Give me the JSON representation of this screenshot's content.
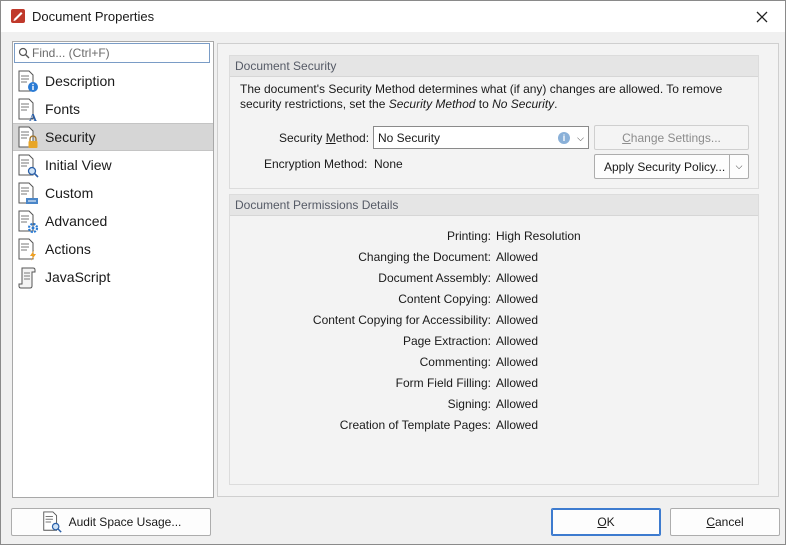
{
  "window": {
    "title": "Document Properties"
  },
  "sidebar": {
    "search_placeholder": "Find... (Ctrl+F)",
    "items": [
      {
        "label": "Description",
        "icon": "document-info-icon"
      },
      {
        "label": "Fonts",
        "icon": "document-font-icon"
      },
      {
        "label": "Security",
        "icon": "document-lock-icon",
        "selected": true
      },
      {
        "label": "Initial View",
        "icon": "document-view-icon"
      },
      {
        "label": "Custom",
        "icon": "document-custom-icon"
      },
      {
        "label": "Advanced",
        "icon": "document-gear-icon"
      },
      {
        "label": "Actions",
        "icon": "document-lightning-icon"
      },
      {
        "label": "JavaScript",
        "icon": "script-scroll-icon"
      }
    ]
  },
  "security": {
    "header": "Document Security",
    "desc_line1": "The document's Security Method determines what (if any) changes are allowed. To remove",
    "desc_line2_prefix": "security restrictions, set the ",
    "desc_line2_italic1": "Security Method",
    "desc_line2_mid": " to ",
    "desc_line2_italic2": "No Security",
    "desc_line2_suffix": ".",
    "method_label_prefix": "Security ",
    "method_label_underlined": "M",
    "method_label_suffix": "ethod:",
    "method_value": "No Security",
    "encryption_label": "Encryption Method:",
    "encryption_value": "None",
    "change_settings_prefix": "",
    "change_settings_underlined": "C",
    "change_settings_suffix": "hange Settings...",
    "apply_policy_label": "Apply Security Policy..."
  },
  "permissions": {
    "header": "Document Permissions Details",
    "rows": [
      {
        "label": "Printing:",
        "value": "High Resolution"
      },
      {
        "label": "Changing the Document:",
        "value": "Allowed"
      },
      {
        "label": "Document Assembly:",
        "value": "Allowed"
      },
      {
        "label": "Content Copying:",
        "value": "Allowed"
      },
      {
        "label": "Content Copying for Accessibility:",
        "value": "Allowed"
      },
      {
        "label": "Page Extraction:",
        "value": "Allowed"
      },
      {
        "label": "Commenting:",
        "value": "Allowed"
      },
      {
        "label": "Form Field Filling:",
        "value": "Allowed"
      },
      {
        "label": "Signing:",
        "value": "Allowed"
      },
      {
        "label": "Creation of Template Pages:",
        "value": "Allowed"
      }
    ]
  },
  "footer": {
    "audit_label": "Audit Space Usage...",
    "ok_underlined": "O",
    "ok_suffix": "K",
    "cancel_underlined": "C",
    "cancel_suffix": "ancel"
  },
  "colors": {
    "accent": "#3d7bcf",
    "selected_bg": "#d6d6d6",
    "app_icon": "#c0392b"
  }
}
